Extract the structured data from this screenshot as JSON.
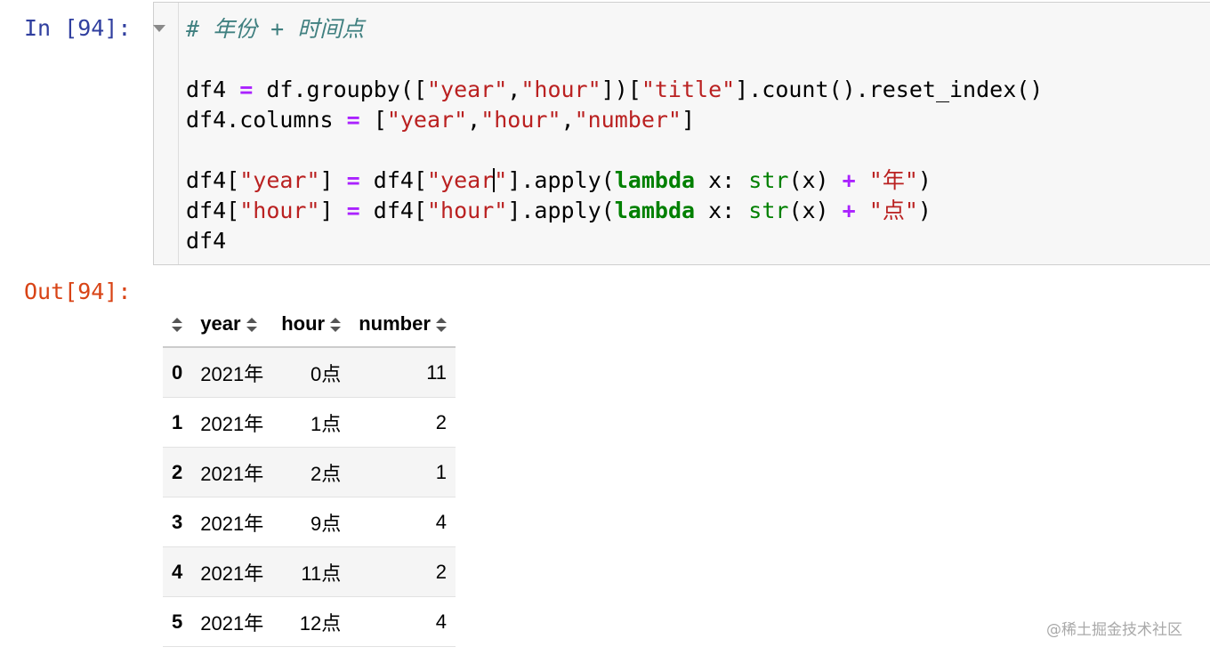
{
  "cell": {
    "in_prompt": "In [94]:",
    "out_prompt": "Out[94]:"
  },
  "code": {
    "comment": "# 年份 + 时间点",
    "line2": {
      "var": "df4",
      "assign": "=",
      "expr_start": "df.groupby([",
      "s_year": "\"year\"",
      "comma": ",",
      "s_hour": "\"hour\"",
      "mid": "])[",
      "s_title": "\"title\"",
      "tail": "].count().reset_index()"
    },
    "line3": {
      "start": "df4.columns",
      "assign": "=",
      "open": "[",
      "s_year": "\"year\"",
      "comma1": ",",
      "s_hour": "\"hour\"",
      "comma2": ",",
      "s_number": "\"number\"",
      "close": "]"
    },
    "line5": {
      "a": "df4[",
      "s_year": "\"year\"",
      "b": "]",
      "assign": "=",
      "c": "df4[",
      "s_year2a": "\"year",
      "s_year2b": "\"",
      "d": "].apply(",
      "kw": "lambda",
      "e": "x:",
      "builtin": "str",
      "f": "(x)",
      "plus": "+",
      "s_nian": "\"年\"",
      "g": ")"
    },
    "line6": {
      "a": "df4[",
      "s_hour": "\"hour\"",
      "b": "]",
      "assign": "=",
      "c": "df4[",
      "s_hour2": "\"hour\"",
      "d": "].apply(",
      "kw": "lambda",
      "e": "x:",
      "builtin": "str",
      "f": "(x)",
      "plus": "+",
      "s_dian": "\"点\"",
      "g": ")"
    },
    "line7": "df4"
  },
  "table": {
    "columns": [
      "year",
      "hour",
      "number"
    ],
    "rows": [
      {
        "index": "0",
        "year": "2021年",
        "hour": "0点",
        "number": "11"
      },
      {
        "index": "1",
        "year": "2021年",
        "hour": "1点",
        "number": "2"
      },
      {
        "index": "2",
        "year": "2021年",
        "hour": "2点",
        "number": "1"
      },
      {
        "index": "3",
        "year": "2021年",
        "hour": "9点",
        "number": "4"
      },
      {
        "index": "4",
        "year": "2021年",
        "hour": "11点",
        "number": "2"
      },
      {
        "index": "5",
        "year": "2021年",
        "hour": "12点",
        "number": "4"
      }
    ]
  },
  "watermark": "@稀土掘金技术社区",
  "icons": {
    "collapse": "collapse-arrow-icon",
    "sort": "sort-icon"
  }
}
